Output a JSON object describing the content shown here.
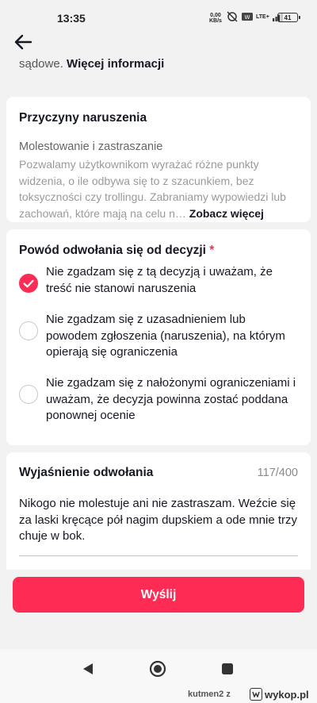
{
  "status_bar": {
    "time": "13:35",
    "net_speed_value": "0,00",
    "net_speed_unit": "KB/s",
    "network_label": "LTE+",
    "battery": "41"
  },
  "icons": {
    "back": "arrow-left-icon",
    "checked": "checkmark-icon",
    "nav_back": "triangle-back-icon",
    "nav_home": "circle-home-icon",
    "nav_recents": "square-recents-icon"
  },
  "colors": {
    "accent": "#fe2c55",
    "background": "#f2f2f3",
    "card": "#ffffff"
  },
  "intro": {
    "text": "sądowe.",
    "link": "Więcej informacji"
  },
  "violation_card": {
    "title": "Przyczyny naruszenia",
    "type": "Molestowanie i zastraszanie",
    "description": "Pozwalamy użytkownikom wyrażać różne punkty widzenia, o ile odbywa się to z szacunkiem, bez toksyczności czy trollingu. Zabraniamy wypowiedzi lub zachowań, które mają na celu n…",
    "see_more": "Zobacz więcej"
  },
  "reason_card": {
    "title": "Powód odwołania się od decyzji",
    "required_mark": "*",
    "options": [
      {
        "label": "Nie zgadzam się z tą decyzją i uważam, że treść nie stanowi naruszenia",
        "selected": true
      },
      {
        "label": "Nie zgadzam się z uzasadnieniem lub powodem zgłoszenia (naruszenia), na którym opierają się ograniczenia",
        "selected": false
      },
      {
        "label": "Nie zgadzam się z nałożonymi ograniczeniami i uważam, że decyzja powinna zostać poddana ponownej ocenie",
        "selected": false
      }
    ]
  },
  "explanation_card": {
    "title": "Wyjaśnienie odwołania",
    "counter": "117/400",
    "text": "Nikogo nie molestuje ani nie zastraszam. Weźcie się za laski kręcące pół nagim dupskiem a ode mnie trzy chuje w bok."
  },
  "submit_label": "Wyślij",
  "watermark": {
    "user": "kutmen2",
    "separator": "z",
    "site": "wykop.pl"
  }
}
